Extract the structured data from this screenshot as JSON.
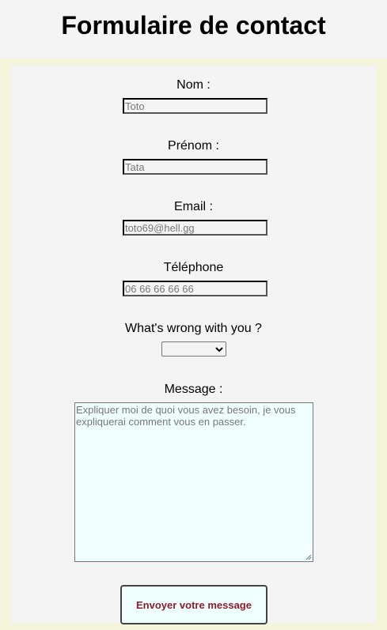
{
  "header": {
    "title": "Formulaire de contact"
  },
  "form": {
    "nom": {
      "label": "Nom :",
      "placeholder": "Toto"
    },
    "prenom": {
      "label": "Prénom :",
      "placeholder": "Tata"
    },
    "email": {
      "label": "Email :",
      "placeholder": "toto69@hell.gg"
    },
    "telephone": {
      "label": "Téléphone",
      "placeholder": "06 66 66 66 66"
    },
    "issue": {
      "label": "What's wrong with you ?",
      "selected_value": ""
    },
    "message": {
      "label": "Message :",
      "placeholder": "Expliquer moi de quoi vous avez besoin, je vous expliquerai comment vous en passer."
    },
    "submit_label": "Envoyer votre message"
  },
  "colors": {
    "frame": "#f5f5dc",
    "panel": "#f4f4f4",
    "textarea_bg": "#f0ffff",
    "button_text": "#8b1e2b"
  }
}
